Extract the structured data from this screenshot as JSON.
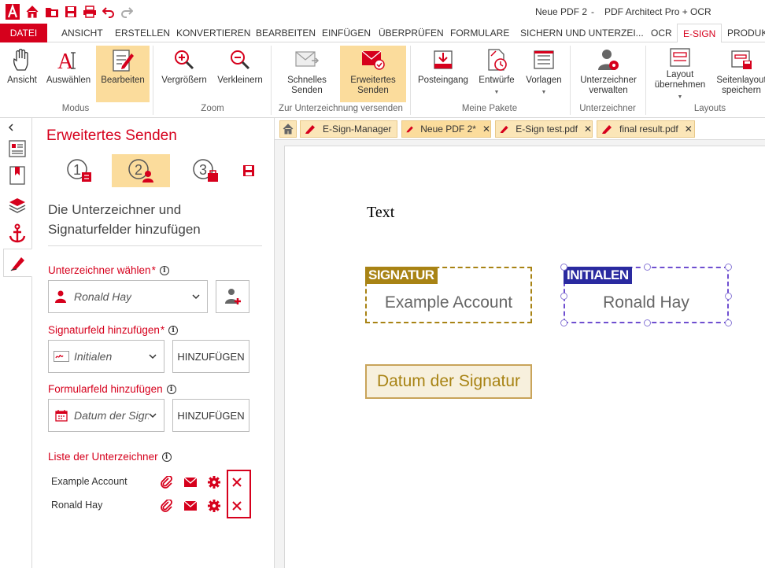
{
  "titlebar": {
    "doc_name": "Neue PDF 2",
    "separator": "-",
    "app_name": "PDF Architect Pro + OCR"
  },
  "tabs": [
    "DATEI",
    "ANSICHT",
    "ERSTELLEN",
    "KONVERTIEREN",
    "BEARBEITEN",
    "EINFÜGEN",
    "ÜBERPRÜFEN",
    "FORMULARE",
    "SICHERN UND UNTERZEI...",
    "OCR",
    "E-SIGN",
    "PRODUKT"
  ],
  "ribbon": {
    "buttons": {
      "ansicht": "Ansicht",
      "auswaehlen": "Auswählen",
      "bearbeiten": "Bearbeiten",
      "vergroessern": "Vergrößern",
      "verkleinern": "Verkleinern",
      "schnelles1": "Schnelles",
      "schnelles2": "Senden",
      "erweitertes1": "Erweitertes",
      "erweitertes2": "Senden",
      "posteingang": "Posteingang",
      "entwuerfe": "Entwürfe",
      "vorlagen": "Vorlagen",
      "unterz1": "Unterzeichner",
      "unterz2": "verwalten",
      "layout1": "Layout",
      "layout2": "übernehmen",
      "seitenlayout1": "Seitenlayout",
      "seitenlayout2": "speichern"
    },
    "groups": {
      "modus": "Modus",
      "zoom": "Zoom",
      "zur_unterzeichnung": "Zur Unterzeichnung versenden",
      "meine_pakete": "Meine Pakete",
      "unterzeichner": "Unterzeichner",
      "layouts": "Layouts"
    }
  },
  "panel": {
    "title": "Erweitertes Senden",
    "steps": [
      "1",
      "2",
      "3"
    ],
    "subtitle": "Die Unterzeichner und Signaturfelder hinzufügen",
    "signer_label": "Unterzeichner wählen",
    "signer_value": "Ronald Hay",
    "sigfield_label": "Signaturfeld hinzufügen",
    "sigfield_value": "Initialen",
    "formfield_label": "Formularfeld hinzufügen",
    "formfield_value": "Datum der Signatur",
    "add_button": "HINZUFÜGEN",
    "list_label": "Liste der Unterzeichner",
    "required_mark": "*",
    "info_mark": "i",
    "signers": [
      "Example Account",
      "Ronald Hay"
    ]
  },
  "doc_tabs": [
    {
      "label": "E-Sign-Manager",
      "closable": false
    },
    {
      "label": "Neue PDF 2*",
      "closable": true
    },
    {
      "label": "E-Sign test.pdf",
      "closable": true
    },
    {
      "label": "final result.pdf",
      "closable": true
    }
  ],
  "document": {
    "text": "Text",
    "signature_tag": "SIGNATUR",
    "signature_name": "Example Account",
    "initials_tag": "INITIALEN",
    "initials_name": "Ronald Hay",
    "date_field": "Datum der Signatur"
  },
  "colors": {
    "accent": "#d6001c",
    "highlight": "#fbdc9c",
    "signature": "#a88314",
    "initials": "#2a2aa0"
  }
}
